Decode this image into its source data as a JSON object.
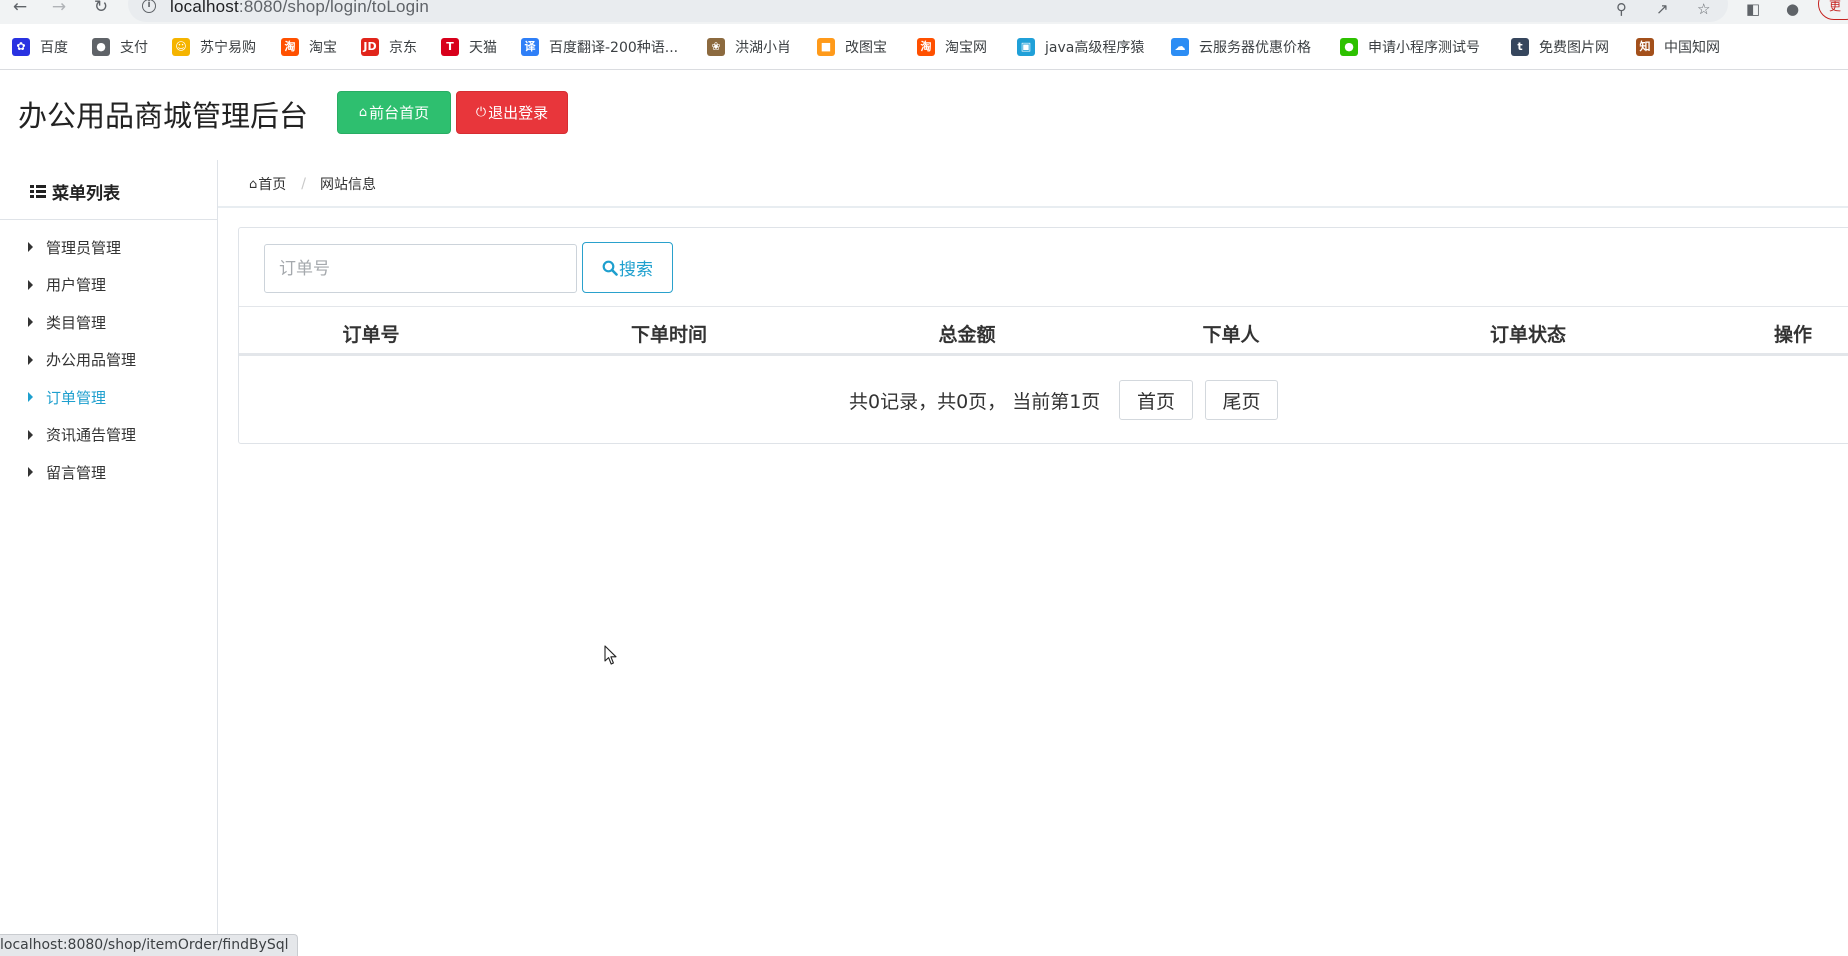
{
  "browser": {
    "url_host": "localhost",
    "url_path": ":8080/shop/login/toLogin",
    "profile_chip": "更",
    "bookmarks": [
      {
        "label": "百度",
        "icon": "baidu-paw-icon",
        "color": "#2932e1"
      },
      {
        "label": "支付",
        "icon": "globe-icon",
        "color": "#5f6368"
      },
      {
        "label": "苏宁易购",
        "icon": "suning-lion-icon",
        "color": "#f5b400"
      },
      {
        "label": "淘宝",
        "icon": "taobao-icon",
        "color": "#ff5000"
      },
      {
        "label": "京东",
        "icon": "jd-icon",
        "color": "#e1251b"
      },
      {
        "label": "天猫",
        "icon": "tmall-icon",
        "color": "#d8001b"
      },
      {
        "label": "百度翻译-200种语...",
        "icon": "translate-icon",
        "color": "#2f7ff7"
      },
      {
        "label": "洪湖小肖",
        "icon": "bird-icon",
        "color": "#8c6a3f"
      },
      {
        "label": "改图宝",
        "icon": "gaitubao-icon",
        "color": "#ff9a1a"
      },
      {
        "label": "淘宝网",
        "icon": "taobao-icon",
        "color": "#ff5000"
      },
      {
        "label": "java高级程序猿",
        "icon": "bilibili-tv-icon",
        "color": "#20a0d8"
      },
      {
        "label": "云服务器优惠价格",
        "icon": "cloud-icon",
        "color": "#2c8df4"
      },
      {
        "label": "申请小程序测试号",
        "icon": "wechat-icon",
        "color": "#2dc100"
      },
      {
        "label": "免费图片网",
        "icon": "tumblr-icon",
        "color": "#36465d"
      },
      {
        "label": "中国知网",
        "icon": "cnki-icon",
        "color": "#a3501b"
      }
    ],
    "status_url": "localhost:8080/shop/itemOrder/findBySql"
  },
  "header": {
    "title": "办公用品商城管理后台",
    "home_button": "前台首页",
    "logout_button": "退出登录"
  },
  "sidebar": {
    "heading": "菜单列表",
    "items": [
      {
        "label": "管理员管理",
        "active": false
      },
      {
        "label": "用户管理",
        "active": false
      },
      {
        "label": "类目管理",
        "active": false
      },
      {
        "label": "办公用品管理",
        "active": false
      },
      {
        "label": "订单管理",
        "active": true
      },
      {
        "label": "资讯通告管理",
        "active": false
      },
      {
        "label": "留言管理",
        "active": false
      }
    ]
  },
  "breadcrumb": {
    "home": "首页",
    "current": "网站信息"
  },
  "search": {
    "placeholder": "订单号",
    "value": "",
    "button": "搜索"
  },
  "table": {
    "columns": [
      "订单号",
      "下单时间",
      "总金额",
      "下单人",
      "订单状态",
      "操作"
    ],
    "rows": []
  },
  "pagination": {
    "summary": "共0记录，共0页， 当前第1页",
    "first": "首页",
    "last": "尾页"
  },
  "colors": {
    "accent": "#1e9fce",
    "home_button": "#2ebf6f",
    "logout_button": "#e8363b"
  }
}
